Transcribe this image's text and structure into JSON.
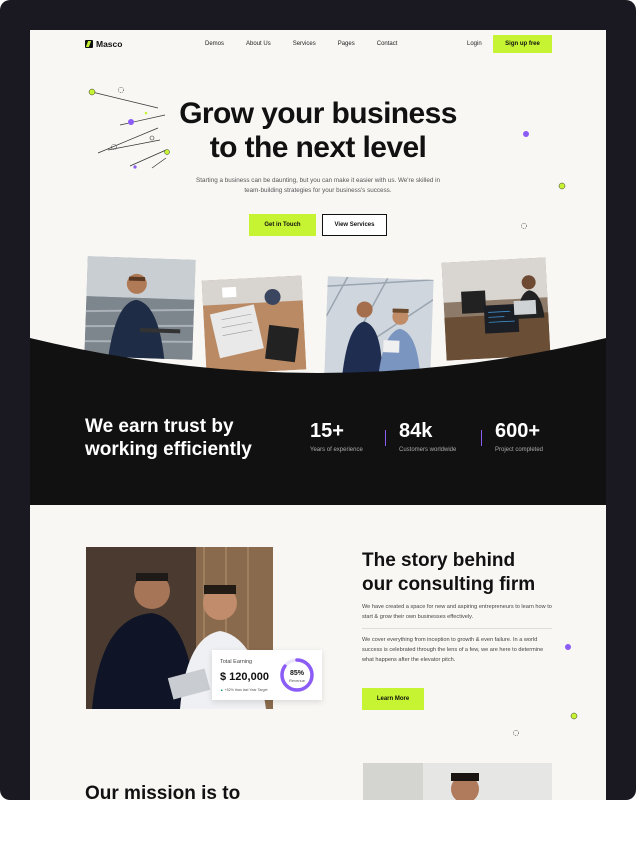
{
  "brand": {
    "name": "Masco"
  },
  "nav": {
    "links": [
      "Demos",
      "About Us",
      "Services",
      "Pages",
      "Contact"
    ],
    "login": "Login",
    "signup": "Sign up free"
  },
  "hero": {
    "title_line1": "Grow your business",
    "title_line2": "to the next level",
    "subtitle": "Starting a business can be daunting, but you can make it easier with us. We're skilled in team-building strategies for your business's success.",
    "cta_primary": "Get in Touch",
    "cta_secondary": "View Services"
  },
  "trust": {
    "title_line1": "We earn trust by",
    "title_line2": "working efficiently",
    "stats": [
      {
        "value": "15+",
        "label": "Years of experience"
      },
      {
        "value": "84k",
        "label": "Customers worldwide"
      },
      {
        "value": "600+",
        "label": "Project completed"
      }
    ]
  },
  "story": {
    "title_line1": "The story behind",
    "title_line2": "our consulting firm",
    "paragraph1": "We have created a space for new and aspiring entrepreneurs to learn how to start & grow their own businesses effectively.",
    "paragraph2": "We cover everything from inception to growth & even failure. In a world success is celebrated through the lens of a few, we are here to determine what happens after the elevator pitch.",
    "cta": "Learn More",
    "card": {
      "label": "Total Earning",
      "value": "$ 120,000",
      "note": "+52% than last Year Target",
      "percent": 85,
      "percent_label": "85%",
      "percent_caption": "Revenue"
    }
  },
  "mission": {
    "title": "Our mission is to"
  },
  "colors": {
    "accent": "#c6f432",
    "purple": "#8b5cf6",
    "dark": "#111111",
    "frame": "#1a1922"
  }
}
